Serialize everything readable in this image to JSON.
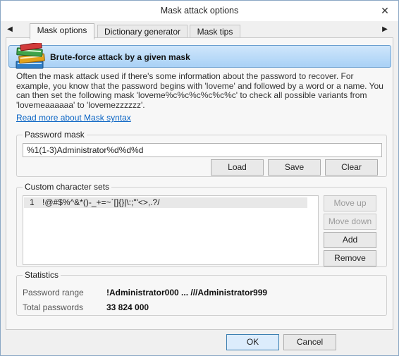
{
  "window": {
    "title": "Mask attack options"
  },
  "tabs": [
    {
      "label": "Mask options",
      "active": true
    },
    {
      "label": "Dictionary generator",
      "active": false
    },
    {
      "label": "Mask tips",
      "active": false
    }
  ],
  "banner": {
    "title": "Brute-force attack by a given mask",
    "icon": "books-icon"
  },
  "description": "Often the mask attack used if there's some information about the password to recover. For example, you know that the password begins with 'loveme' and followed by a word or a name. You can then set the following mask 'loveme%c%c%c%c%c%c' to check all possible variants from 'lovemeaaaaaa' to 'lovemezzzzzz'.",
  "link": "Read more about Mask syntax",
  "password_mask": {
    "label": "Password mask",
    "value": "%1(1-3)Administrator%d%d%d",
    "buttons": {
      "load": "Load",
      "save": "Save",
      "clear": "Clear"
    }
  },
  "custom_sets": {
    "label": "Custom character sets",
    "rows": [
      {
        "num": "1",
        "value": "!@#$%^&*()-_+=~`[]{}|\\:;\"'<>,.?/"
      }
    ],
    "buttons": {
      "move_up": "Move up",
      "move_down": "Move down",
      "add": "Add",
      "remove": "Remove"
    }
  },
  "statistics": {
    "label": "Statistics",
    "range_label": "Password range",
    "range_value": "!Administrator000 ... ///Administrator999",
    "total_label": "Total passwords",
    "total_value": "33 824 000"
  },
  "footer": {
    "ok": "OK",
    "cancel": "Cancel"
  },
  "colors": {
    "accent": "#3c7fb1",
    "link": "#0a64c4",
    "banner": "#a9d1f6"
  }
}
